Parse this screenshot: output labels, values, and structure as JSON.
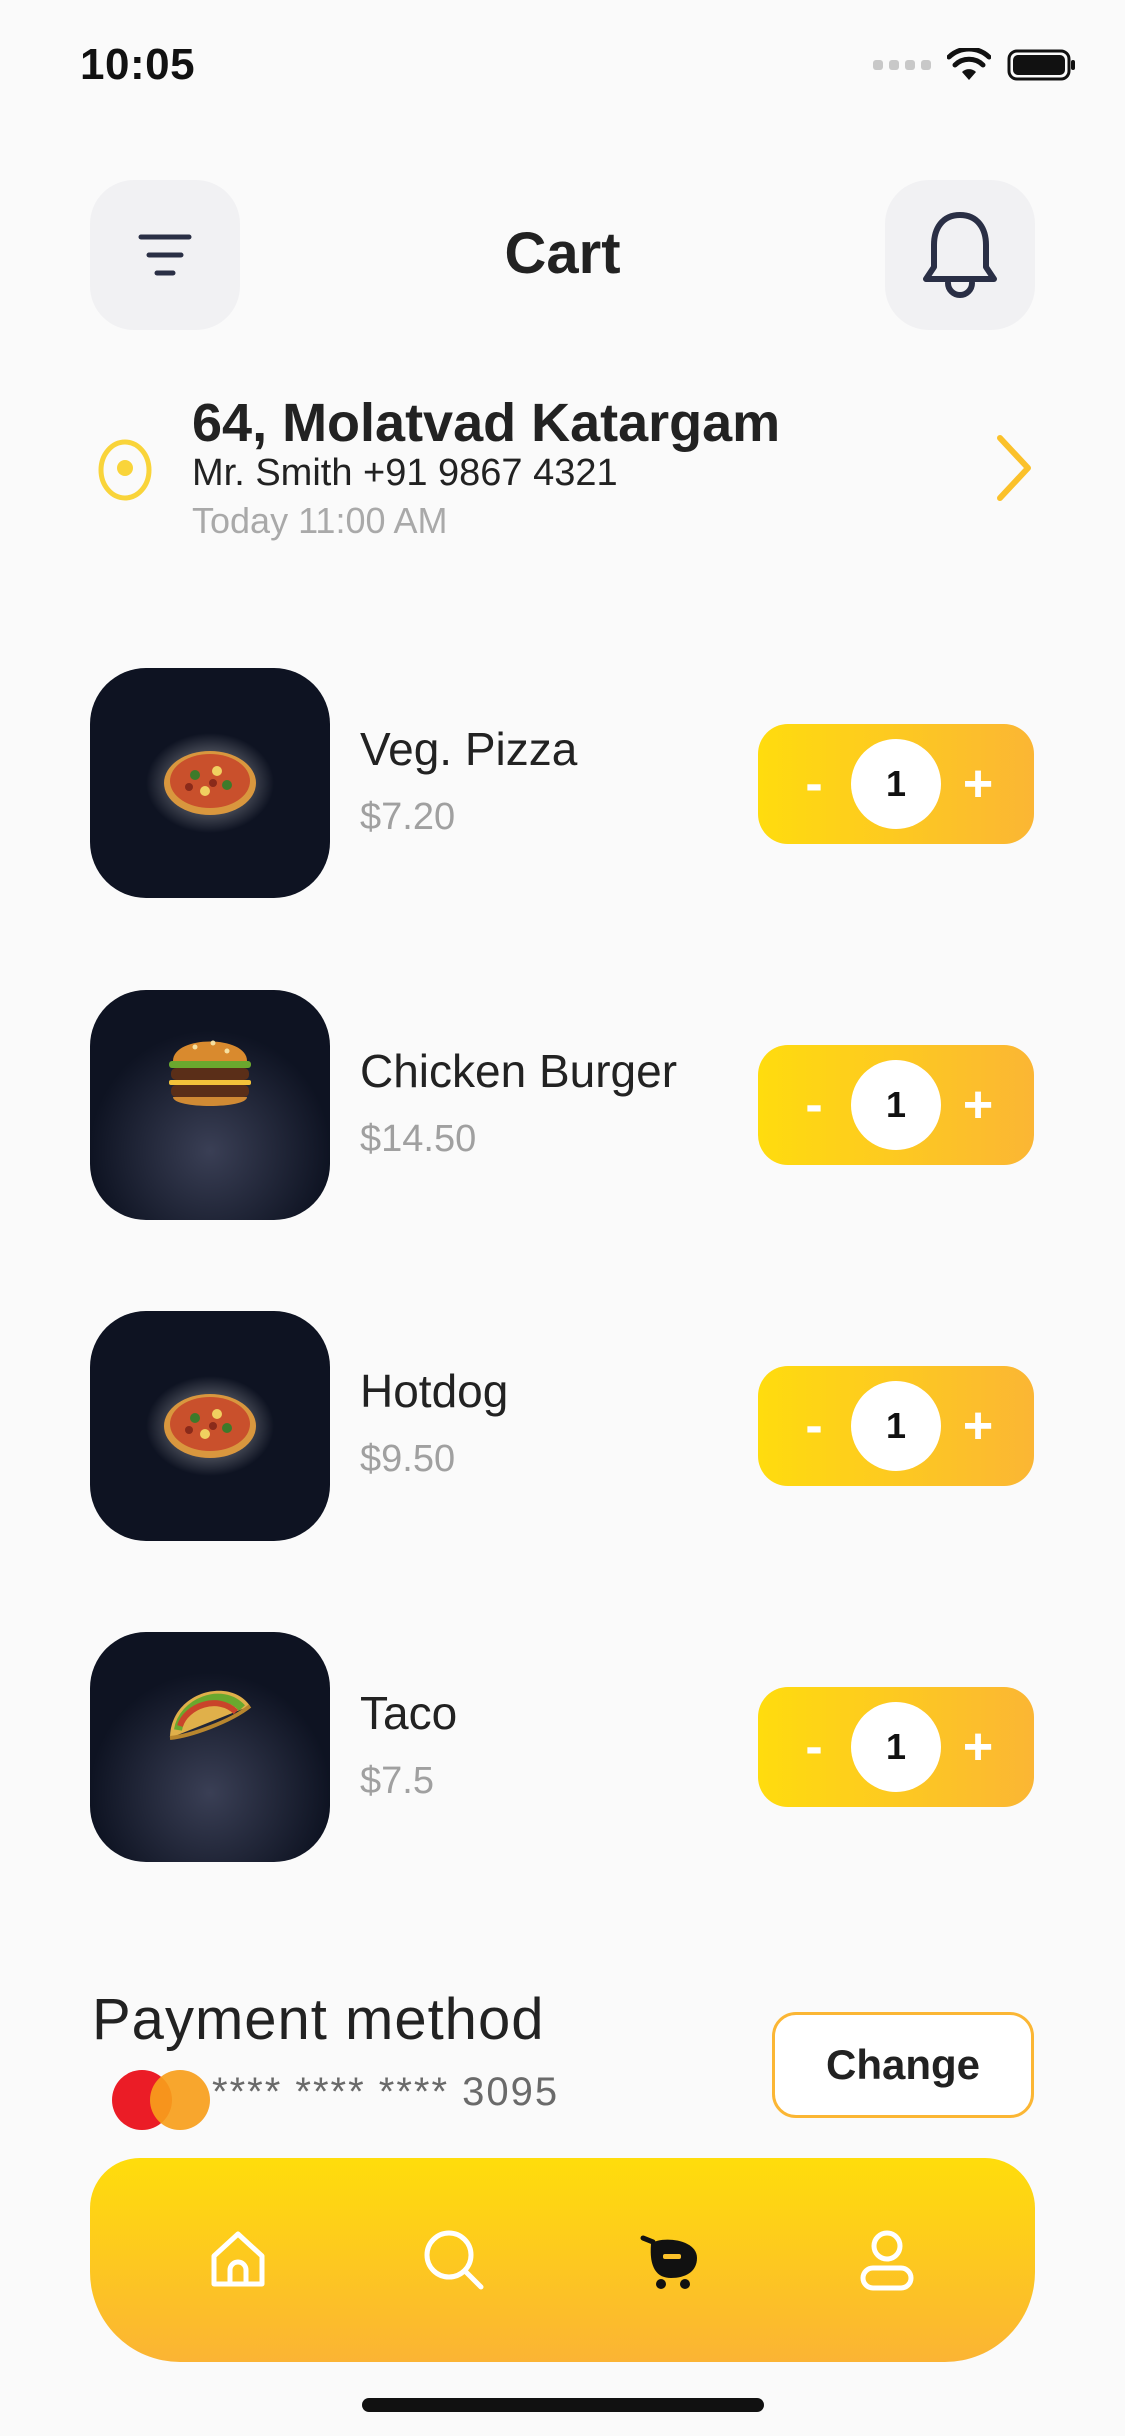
{
  "status_bar": {
    "time": "10:05"
  },
  "header": {
    "title": "Cart",
    "filter_icon": "filter-lines-icon",
    "notification_icon": "bell-icon"
  },
  "address": {
    "icon": "location-pin-icon",
    "line1": "64, Molatvad Katargam",
    "line2": "Mr. Smith +91 9867 4321",
    "line3": "Today 11:00 AM",
    "chevron_icon": "chevron-right-icon"
  },
  "cart_items": [
    {
      "name": "Veg. Pizza",
      "price": "$7.20",
      "qty": "1",
      "minus": "-",
      "plus": "+",
      "image": "pizza"
    },
    {
      "name": "Chicken Burger",
      "price": "$14.50",
      "qty": "1",
      "minus": "-",
      "plus": "+",
      "image": "burger"
    },
    {
      "name": "Hotdog",
      "price": "$9.50",
      "qty": "1",
      "minus": "-",
      "plus": "+",
      "image": "pizza"
    },
    {
      "name": "Taco",
      "price": "$7.5",
      "qty": "1",
      "minus": "-",
      "plus": "+",
      "image": "taco"
    }
  ],
  "payment": {
    "title": "Payment method",
    "card_number": "**** **** **** 3095",
    "card_brand_icon": "mastercard-icon",
    "change_label": "Change"
  },
  "bottom_nav": {
    "items": [
      {
        "icon": "home-icon",
        "active": false
      },
      {
        "icon": "search-icon",
        "active": false
      },
      {
        "icon": "cart-icon",
        "active": true
      },
      {
        "icon": "profile-icon",
        "active": false
      }
    ]
  },
  "colors": {
    "accent_start": "#ffdc0e",
    "accent_end": "#fbb634",
    "image_bg": "#0e1322",
    "muted_text": "#a0a0a0"
  }
}
